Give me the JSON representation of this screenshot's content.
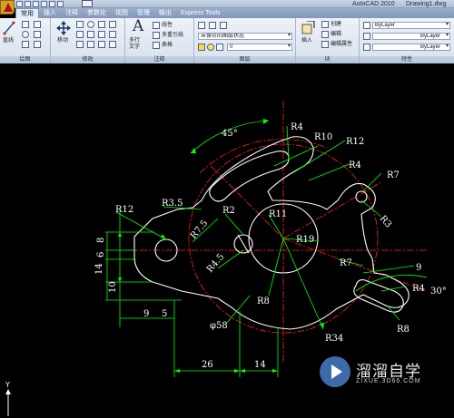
{
  "titlebar": {
    "app_name": "AutoCAD 2010",
    "file_name": "Drawing1.dwg"
  },
  "tabs": [
    "常用",
    "插入",
    "注释",
    "参数化",
    "视图",
    "管理",
    "输出",
    "Express Tools"
  ],
  "active_tab": "常用",
  "ribbon": {
    "draw": {
      "title": "绘图",
      "line_label": "直线"
    },
    "modify": {
      "title": "修改",
      "move_label": "移动"
    },
    "annotation": {
      "title": "注释",
      "multiline_text_label": "多行\n文字",
      "linear_label": "线性",
      "multileader_label": "多重引线",
      "table_label": "表格"
    },
    "layers": {
      "title": "图层",
      "layer_state_value": "未保存的图层状态",
      "current_layer_value": "0"
    },
    "block": {
      "title": "块",
      "insert_label": "插入",
      "create_label": "创建",
      "edit_label": "编辑",
      "edit_attr_label": "编辑属性"
    },
    "properties": {
      "title": "特性",
      "color_value": "ByLayer",
      "linetype_value": "ByLayer",
      "lineweight_value": "ByLayer"
    }
  },
  "dimensions": {
    "angle_45": "45°",
    "r4_top": "R4",
    "r10": "R10",
    "r12_top": "R12",
    "r4_mid": "R4",
    "r7_top": "R7",
    "r12_left": "R12",
    "r3_5": "R3.5",
    "r7_5": "R7.5",
    "r2": "R2",
    "r11": "R11",
    "r3": "R3",
    "r19": "R19",
    "r4_5": "R4.5",
    "r7_right": "R7",
    "r8_center": "R8",
    "r4_right": "R4",
    "angle_30": "30°",
    "r8_right": "R8",
    "nine_right": "9",
    "d58": "φ58",
    "r34": "R34",
    "v8": "8",
    "v6": "6",
    "v14": "14",
    "v10": "10",
    "h9": "9",
    "h5": "5",
    "h26": "26",
    "h14": "14"
  },
  "ucs": {
    "y_label": "Y"
  },
  "watermark": {
    "brand": "溜溜自学",
    "site": "ZIXUE.3D66.COM"
  },
  "colors": {
    "dimension_green": "#00ff00",
    "centerline_red": "#ff2020",
    "geometry_white": "#ffffff",
    "ribbon_tab_blue": "#8297b8"
  }
}
